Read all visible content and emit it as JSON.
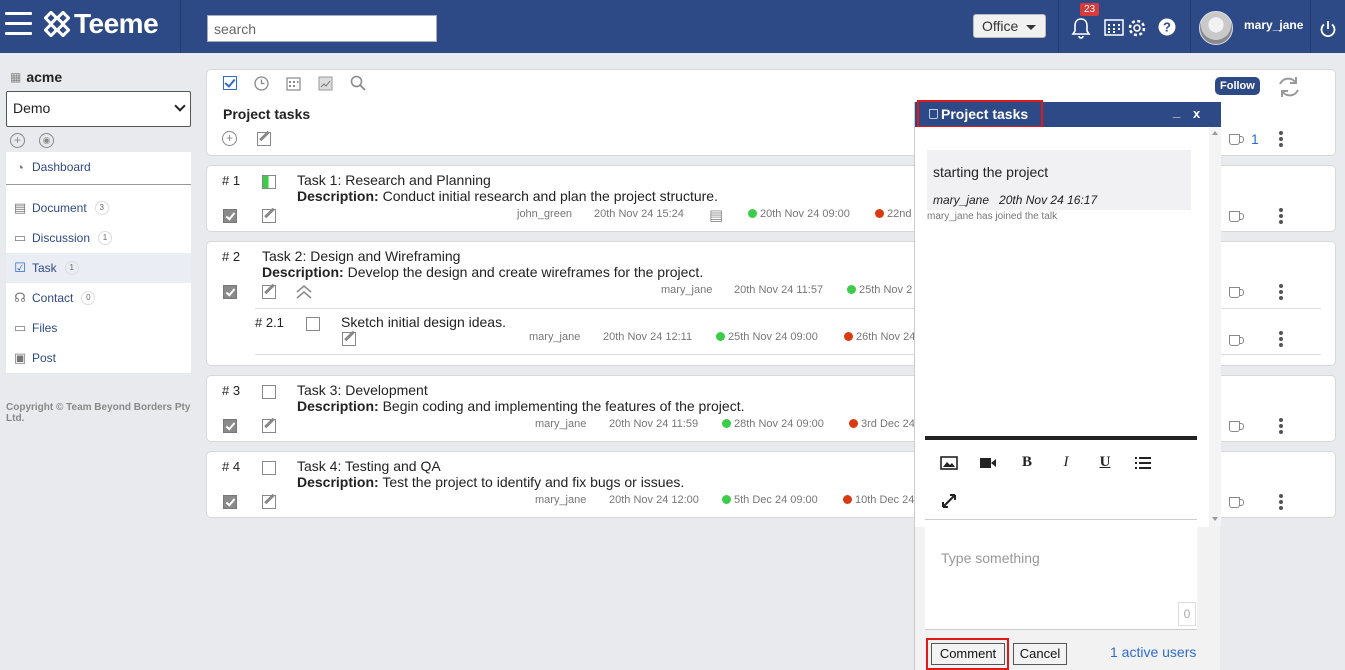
{
  "app": {
    "brand": "Teeme",
    "search_placeholder": "search",
    "space": "Office",
    "notifications": "23",
    "username": "mary_jane"
  },
  "sidebar": {
    "org": "acme",
    "workspace": "Demo",
    "items": [
      {
        "label": "Dashboard",
        "count": ""
      },
      {
        "label": "Document",
        "count": "3"
      },
      {
        "label": "Discussion",
        "count": "1"
      },
      {
        "label": "Task",
        "count": "1"
      },
      {
        "label": "Contact",
        "count": "0"
      },
      {
        "label": "Files",
        "count": ""
      },
      {
        "label": "Post",
        "count": ""
      }
    ],
    "copyright": "Copyright © Team Beyond Borders Pty Ltd."
  },
  "main": {
    "header": {
      "title": "Project tasks",
      "follow": "Follow",
      "link_count": "1"
    },
    "tasks": [
      {
        "num": "# 1",
        "title": "Task 1: Research and Planning",
        "desc_label": "Description:",
        "desc": " Conduct initial research and plan the project structure.",
        "author": "john_green",
        "created": "20th Nov 24 15:24",
        "start": "20th Nov 24 09:00",
        "end": "22nd",
        "progress": 0.45
      },
      {
        "num": "# 2",
        "title": "Task 2: Design and Wireframing",
        "desc_label": "Description:",
        "desc": " Develop the design and create wireframes for the project.",
        "author": "mary_jane",
        "created": "20th Nov 24 11:57",
        "start": "25th Nov 2",
        "end": ""
      },
      {
        "num": "# 3",
        "title": "Task 3: Development",
        "desc_label": "Description:",
        "desc": " Begin coding and implementing the features of the project.",
        "author": "mary_jane",
        "created": "20th Nov 24 11:59",
        "start": "28th Nov 24 09:00",
        "end": "3rd Dec 24"
      },
      {
        "num": "# 4",
        "title": "Task 4: Testing and QA",
        "desc_label": "Description:",
        "desc": " Test the project to identify and fix bugs or issues.",
        "author": "mary_jane",
        "created": "20th Nov 24 12:00",
        "start": "5th Dec 24 09:00",
        "end": "10th Dec 24"
      }
    ],
    "subtask": {
      "num": "# 2.1",
      "title": "Sketch initial design ideas.",
      "author": "mary_jane",
      "created": "20th Nov 24 12:11",
      "start": "25th Nov 24 09:00",
      "end": "26th Nov 24"
    }
  },
  "chat": {
    "title": "Project tasks",
    "minimize": "_",
    "close": "x",
    "message": {
      "text": "starting the project",
      "author": "mary_jane",
      "time": "20th Nov 24 16:17"
    },
    "system_note": "mary_jane has joined the talk",
    "placeholder": "Type something",
    "char_count": "0",
    "comment_btn": "Comment",
    "cancel_btn": "Cancel",
    "active_users": "1 active users"
  },
  "colors": {
    "nav": "#2e4a86",
    "accent": "#2e6bd0",
    "highlight": "#e01818",
    "green": "#3bcc4a",
    "red": "#d93a10"
  }
}
